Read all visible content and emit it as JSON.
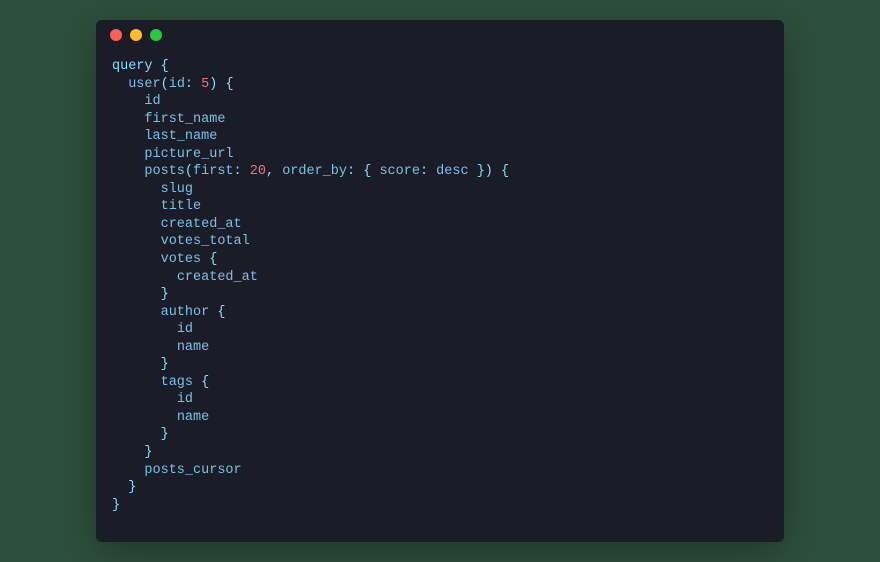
{
  "window": {
    "buttons": [
      "close",
      "minimize",
      "zoom"
    ]
  },
  "syntax": {
    "keyword_color": "#89ddff",
    "field_color": "#7cc0e8",
    "punct_color": "#89ddff",
    "number_color": "#f07178"
  },
  "code": {
    "lines": [
      {
        "i": 0,
        "tokens": [
          [
            "kw",
            "query"
          ],
          [
            "txt",
            " "
          ],
          [
            "pn",
            "{"
          ]
        ]
      },
      {
        "i": 1,
        "tokens": [
          [
            "fld",
            "user"
          ],
          [
            "pn",
            "("
          ],
          [
            "fld",
            "id"
          ],
          [
            "pn",
            ":"
          ],
          [
            "txt",
            " "
          ],
          [
            "num",
            "5"
          ],
          [
            "pn",
            ")"
          ],
          [
            "txt",
            " "
          ],
          [
            "pn",
            "{"
          ]
        ]
      },
      {
        "i": 2,
        "tokens": [
          [
            "fld",
            "id"
          ]
        ]
      },
      {
        "i": 2,
        "tokens": [
          [
            "fld",
            "first_name"
          ]
        ]
      },
      {
        "i": 2,
        "tokens": [
          [
            "fld",
            "last_name"
          ]
        ]
      },
      {
        "i": 2,
        "tokens": [
          [
            "fld",
            "picture_url"
          ]
        ]
      },
      {
        "i": 2,
        "tokens": [
          [
            "fld",
            "posts"
          ],
          [
            "pn",
            "("
          ],
          [
            "fld",
            "first"
          ],
          [
            "pn",
            ":"
          ],
          [
            "txt",
            " "
          ],
          [
            "num",
            "20"
          ],
          [
            "pn",
            ","
          ],
          [
            "txt",
            " "
          ],
          [
            "fld",
            "order_by"
          ],
          [
            "pn",
            ":"
          ],
          [
            "txt",
            " "
          ],
          [
            "pn",
            "{"
          ],
          [
            "txt",
            " "
          ],
          [
            "fld",
            "score"
          ],
          [
            "pn",
            ":"
          ],
          [
            "txt",
            " "
          ],
          [
            "fld",
            "desc"
          ],
          [
            "txt",
            " "
          ],
          [
            "pn",
            "}"
          ],
          [
            "pn",
            ")"
          ],
          [
            "txt",
            " "
          ],
          [
            "pn",
            "{"
          ]
        ]
      },
      {
        "i": 3,
        "tokens": [
          [
            "fld",
            "slug"
          ]
        ]
      },
      {
        "i": 3,
        "tokens": [
          [
            "fld",
            "title"
          ]
        ]
      },
      {
        "i": 3,
        "tokens": [
          [
            "fld",
            "created_at"
          ]
        ]
      },
      {
        "i": 3,
        "tokens": [
          [
            "fld",
            "votes_total"
          ]
        ]
      },
      {
        "i": 3,
        "tokens": [
          [
            "fld",
            "votes"
          ],
          [
            "txt",
            " "
          ],
          [
            "pn",
            "{"
          ]
        ]
      },
      {
        "i": 4,
        "tokens": [
          [
            "fld",
            "created_at"
          ]
        ]
      },
      {
        "i": 3,
        "tokens": [
          [
            "pn",
            "}"
          ]
        ]
      },
      {
        "i": 3,
        "tokens": [
          [
            "fld",
            "author"
          ],
          [
            "txt",
            " "
          ],
          [
            "pn",
            "{"
          ]
        ]
      },
      {
        "i": 4,
        "tokens": [
          [
            "fld",
            "id"
          ]
        ]
      },
      {
        "i": 4,
        "tokens": [
          [
            "fld",
            "name"
          ]
        ]
      },
      {
        "i": 3,
        "tokens": [
          [
            "pn",
            "}"
          ]
        ]
      },
      {
        "i": 3,
        "tokens": [
          [
            "fld",
            "tags"
          ],
          [
            "txt",
            " "
          ],
          [
            "pn",
            "{"
          ]
        ]
      },
      {
        "i": 4,
        "tokens": [
          [
            "fld",
            "id"
          ]
        ]
      },
      {
        "i": 4,
        "tokens": [
          [
            "fld",
            "name"
          ]
        ]
      },
      {
        "i": 3,
        "tokens": [
          [
            "pn",
            "}"
          ]
        ]
      },
      {
        "i": 2,
        "tokens": [
          [
            "pn",
            "}"
          ]
        ]
      },
      {
        "i": 2,
        "tokens": [
          [
            "fld",
            "posts_cursor"
          ]
        ]
      },
      {
        "i": 1,
        "tokens": [
          [
            "pn",
            "}"
          ]
        ]
      },
      {
        "i": 0,
        "tokens": [
          [
            "pn",
            "}"
          ]
        ]
      }
    ]
  }
}
